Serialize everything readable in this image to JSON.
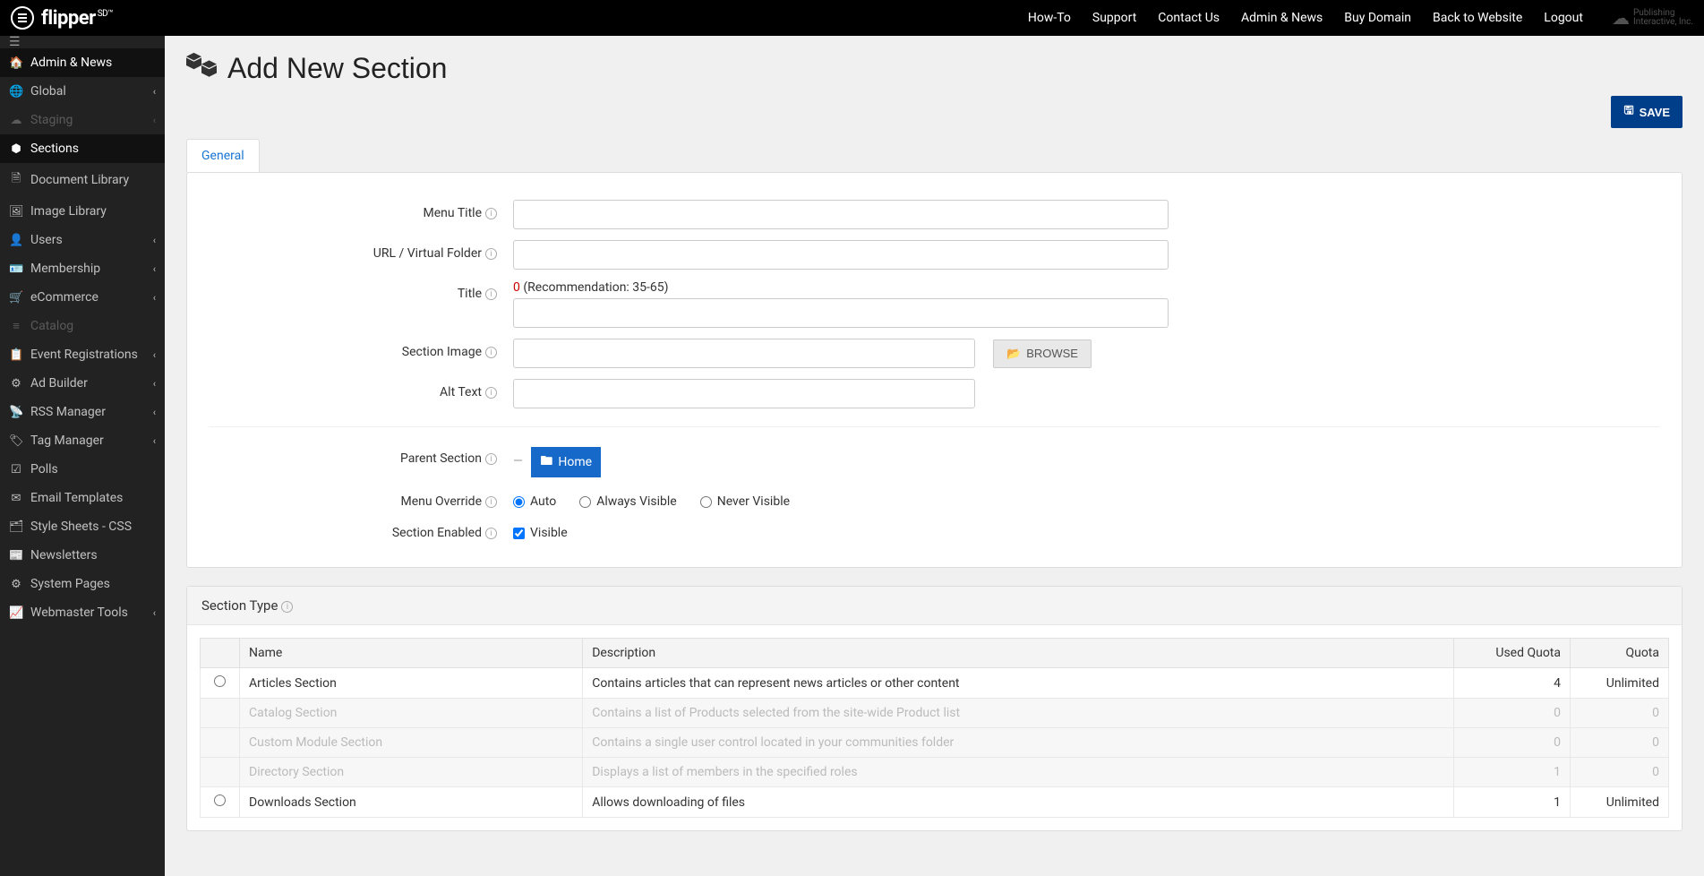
{
  "header": {
    "nav": [
      "How-To",
      "Support",
      "Contact Us",
      "Admin & News",
      "Buy Domain",
      "Back to Website",
      "Logout"
    ]
  },
  "sidebar": {
    "items": [
      {
        "icon": "🏠",
        "label": "Admin & News",
        "active": true
      },
      {
        "icon": "🌐",
        "label": "Global",
        "chevron": true
      },
      {
        "icon": "☁",
        "label": "Staging",
        "chevron": true,
        "disabled": true
      },
      {
        "icon": "⬢",
        "label": "Sections",
        "active": true
      },
      {
        "icon": "🗎",
        "label": "Document Library"
      },
      {
        "icon": "🖼",
        "label": "Image Library"
      },
      {
        "icon": "👤",
        "label": "Users",
        "chevron": true
      },
      {
        "icon": "🪪",
        "label": "Membership",
        "chevron": true
      },
      {
        "icon": "🛒",
        "label": "eCommerce",
        "chevron": true
      },
      {
        "icon": "≡",
        "label": "Catalog",
        "disabled": true
      },
      {
        "icon": "📋",
        "label": "Event Registrations",
        "chevron": true
      },
      {
        "icon": "⚙",
        "label": "Ad Builder",
        "chevron": true
      },
      {
        "icon": "📡",
        "label": "RSS Manager",
        "chevron": true
      },
      {
        "icon": "🏷",
        "label": "Tag Manager",
        "chevron": true
      },
      {
        "icon": "☑",
        "label": "Polls"
      },
      {
        "icon": "✉",
        "label": "Email Templates"
      },
      {
        "icon": "🗂",
        "label": "Style Sheets - CSS"
      },
      {
        "icon": "📰",
        "label": "Newsletters"
      },
      {
        "icon": "⚙",
        "label": "System Pages"
      },
      {
        "icon": "📈",
        "label": "Webmaster Tools",
        "chevron": true
      }
    ]
  },
  "page": {
    "title": "Add New Section",
    "save": "SAVE"
  },
  "tabs": {
    "general": "General"
  },
  "form": {
    "menu_title": "Menu Title",
    "url_folder": "URL / Virtual Folder",
    "title": "Title",
    "title_count": "0",
    "title_hint": " (Recommendation: 35-65)",
    "section_image": "Section Image",
    "browse": "BROWSE",
    "alt_text": "Alt Text",
    "parent_section": "Parent Section",
    "parent_home": "Home",
    "menu_override": "Menu Override",
    "mo_auto": "Auto",
    "mo_always": "Always Visible",
    "mo_never": "Never Visible",
    "section_enabled": "Section Enabled",
    "visible": "Visible"
  },
  "section_type": {
    "title": "Section Type",
    "columns": {
      "name": "Name",
      "description": "Description",
      "used_quota": "Used Quota",
      "quota": "Quota"
    },
    "rows": [
      {
        "selectable": true,
        "name": "Articles Section",
        "desc": "Contains articles that can represent news articles or other content",
        "used": "4",
        "quota": "Unlimited"
      },
      {
        "selectable": false,
        "name": "Catalog Section",
        "desc": "Contains a list of Products selected from the site-wide Product list",
        "used": "0",
        "quota": "0"
      },
      {
        "selectable": false,
        "name": "Custom Module Section",
        "desc": "Contains a single user control located in your communities folder",
        "used": "0",
        "quota": "0"
      },
      {
        "selectable": false,
        "name": "Directory Section",
        "desc": "Displays a list of members in the specified roles",
        "used": "1",
        "quota": "0"
      },
      {
        "selectable": true,
        "name": "Downloads Section",
        "desc": "Allows downloading of files",
        "used": "1",
        "quota": "Unlimited"
      }
    ]
  }
}
